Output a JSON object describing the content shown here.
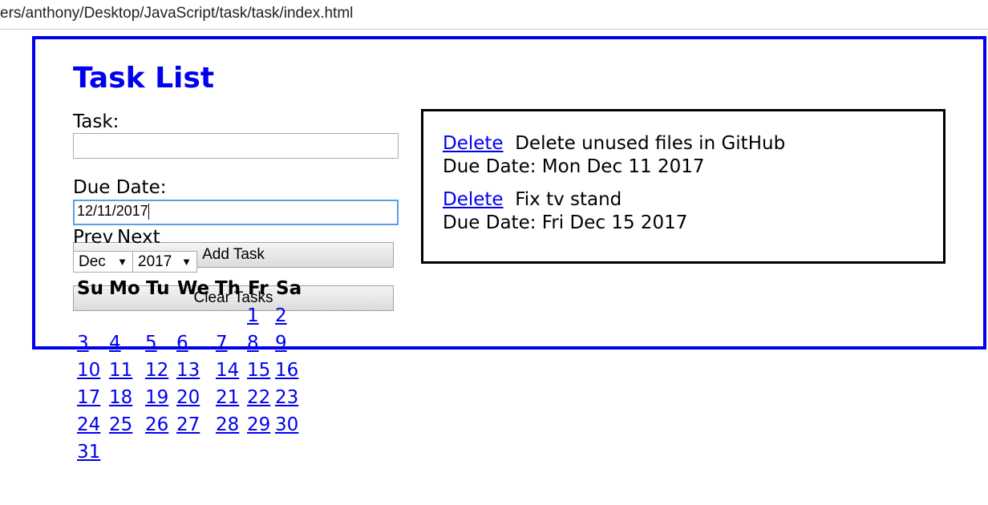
{
  "browser": {
    "url": "ers/anthony/Desktop/JavaScript/task/task/index.html"
  },
  "page": {
    "title": "Task List"
  },
  "form": {
    "task_label": "Task:",
    "task_value": "",
    "due_label": "Due Date:",
    "due_value": "12/11/2017",
    "add_button": "Add Task",
    "clear_button": "Clear Tasks"
  },
  "calendar": {
    "prev": "Prev",
    "next": "Next",
    "month": "Dec",
    "year": "2017",
    "weekdays": [
      "Su",
      "Mo",
      "Tu",
      "We",
      "Th",
      "Fr",
      "Sa"
    ],
    "days": [
      "1",
      "2",
      "3",
      "4",
      "5",
      "6",
      "7",
      "8",
      "9",
      "10",
      "11",
      "12",
      "13",
      "14",
      "15",
      "16",
      "17",
      "18",
      "19",
      "20",
      "21",
      "22",
      "23",
      "24",
      "25",
      "26",
      "27",
      "28",
      "29",
      "30",
      "31"
    ]
  },
  "tasks": [
    {
      "delete": "Delete",
      "name": "Delete unused files in GitHub",
      "due": "Due Date: Mon Dec 11 2017"
    },
    {
      "delete": "Delete",
      "name": "Fix tv stand",
      "due": "Due Date: Fri Dec 15 2017"
    }
  ],
  "colors": {
    "accent": "#0000ee",
    "focus": "#5b9ee8"
  },
  "icons": {
    "dropdown": "dropdown-arrow-icon"
  }
}
